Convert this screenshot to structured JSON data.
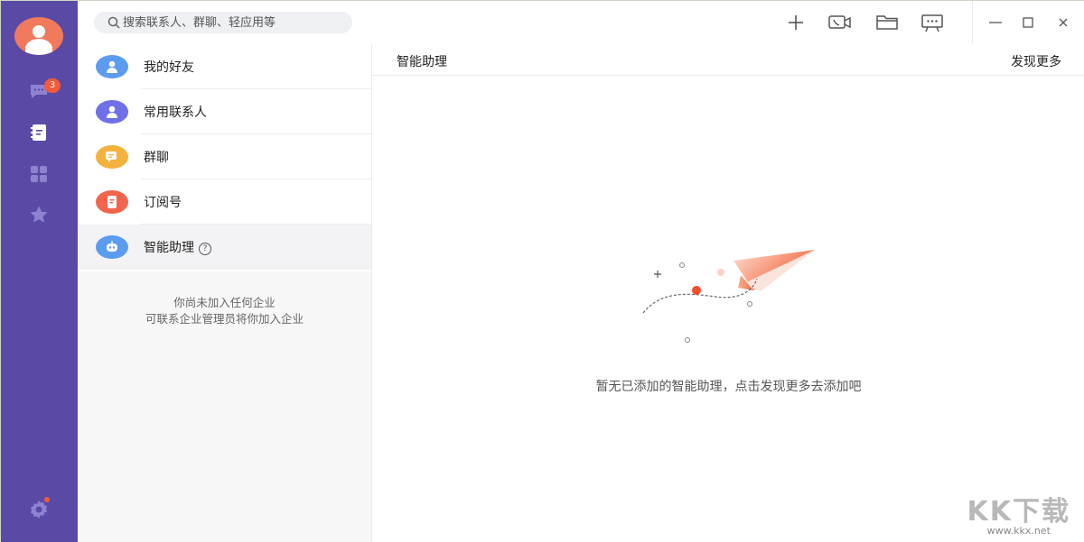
{
  "rail": {
    "badge_count": "3",
    "items": [
      "chat-icon",
      "contacts-icon",
      "apps-icon",
      "star-icon",
      "settings-icon"
    ],
    "colors": {
      "background": "#5a4aa6",
      "badge": "#f25a3c",
      "avatar": "#f27a5c"
    }
  },
  "topbar": {
    "search_placeholder": "搜索联系人、群聊、轻应用等",
    "icons": [
      "add-icon",
      "video-call-icon",
      "folder-icon",
      "screen-share-icon",
      "minimize-icon",
      "maximize-icon",
      "close-icon"
    ]
  },
  "list": {
    "items": [
      {
        "label": "我的好友",
        "icon": "friend-icon",
        "color": "#5b9cf0"
      },
      {
        "label": "常用联系人",
        "icon": "contact-icon",
        "color": "#6f6fe8"
      },
      {
        "label": "群聊",
        "icon": "group-chat-icon",
        "color": "#f5b13d"
      },
      {
        "label": "订阅号",
        "icon": "subscription-icon",
        "color": "#f2644b"
      },
      {
        "label": "智能助理",
        "icon": "robot-icon",
        "color": "#5b9cf0",
        "help": "?"
      }
    ],
    "note_line1": "你尚未加入任何企业",
    "note_line2": "可联系企业管理员将你加入企业"
  },
  "main": {
    "title": "智能助理",
    "discover_label": "发现更多",
    "empty_text": "暂无已添加的智能助理，点击发现更多去添加吧"
  },
  "watermark": {
    "big": "KK下载",
    "small": "www.kkx.net"
  }
}
